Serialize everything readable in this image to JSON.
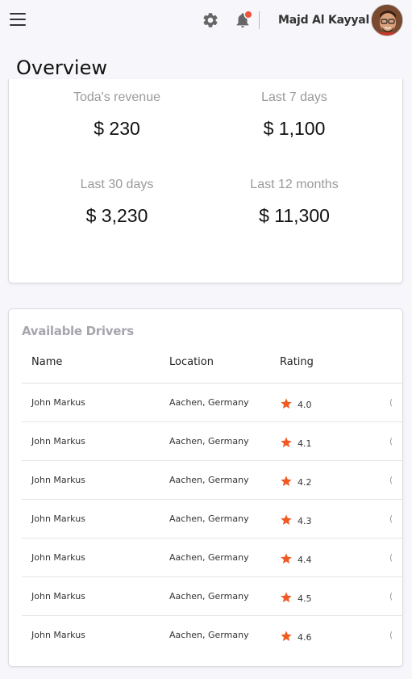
{
  "header": {
    "user_name": "Majd Al Kayyal",
    "notification_dot_color": "#f0533a",
    "icons": [
      "menu-icon",
      "gear-icon",
      "bell-icon"
    ]
  },
  "page_title": "Overview",
  "revenue": {
    "stats": [
      {
        "label": "Toda's revenue",
        "value": "$ 230"
      },
      {
        "label": "Last 7 days",
        "value": "$ 1,100"
      },
      {
        "label": "Last 30 days",
        "value": "$ 3,230"
      },
      {
        "label": "Last 12 months",
        "value": "$ 11,300"
      }
    ]
  },
  "drivers": {
    "title": "Available Drivers",
    "columns": [
      "Name",
      "Location",
      "Rating"
    ],
    "star_color": "#f15a24",
    "rows": [
      {
        "name": "John Markus",
        "location": "Aachen, Germany",
        "rating": "4.0"
      },
      {
        "name": "John Markus",
        "location": "Aachen, Germany",
        "rating": "4.1"
      },
      {
        "name": "John Markus",
        "location": "Aachen, Germany",
        "rating": "4.2"
      },
      {
        "name": "John Markus",
        "location": "Aachen, Germany",
        "rating": "4.3"
      },
      {
        "name": "John Markus",
        "location": "Aachen, Germany",
        "rating": "4.4"
      },
      {
        "name": "John Markus",
        "location": "Aachen, Germany",
        "rating": "4.5"
      },
      {
        "name": "John Markus",
        "location": "Aachen, Germany",
        "rating": "4.6"
      }
    ]
  }
}
